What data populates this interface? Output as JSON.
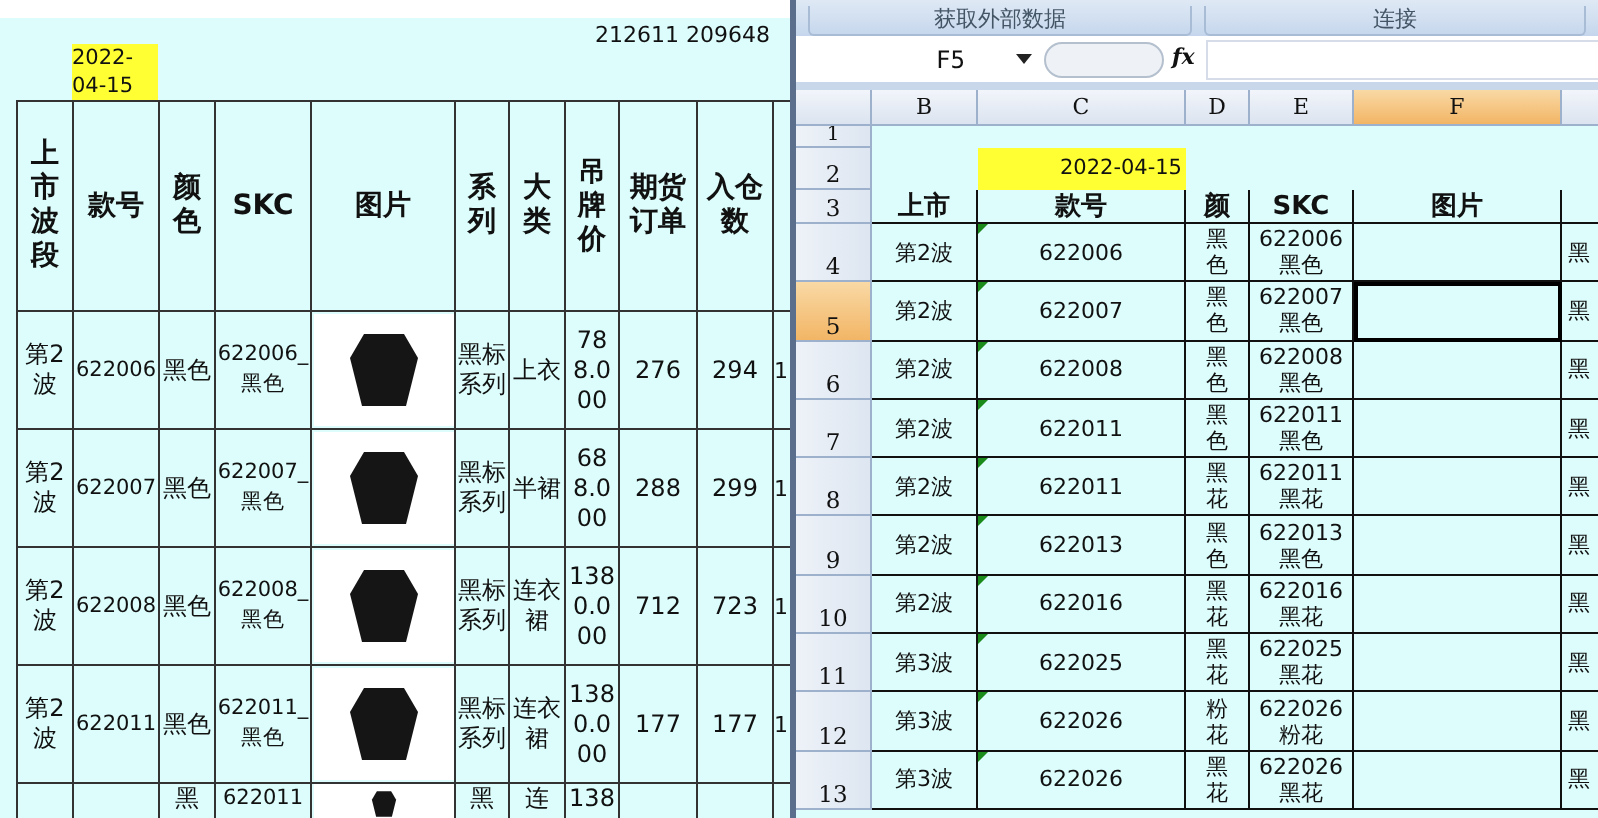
{
  "report": {
    "totals": "212611 209648",
    "date": "2022-04-15",
    "columns": [
      "上市波段",
      "款号",
      "颜色",
      "SKC",
      "图片",
      "系列",
      "大类",
      "吊牌价",
      "期货订单",
      "入仓数"
    ],
    "rows": [
      {
        "wave": "第2波",
        "style_no": "622006",
        "color_name": "黑色",
        "skc": "622006_黑色",
        "series": "黑标系列",
        "category": "上衣",
        "tag_price": "788.000",
        "futures_order": "276",
        "warehouse_qty": "294",
        "column_11": "1"
      },
      {
        "wave": "第2波",
        "style_no": "622007",
        "color_name": "黑色",
        "skc": "622007_黑色",
        "series": "黑标系列",
        "category": "半裙",
        "tag_price": "688.000",
        "futures_order": "288",
        "warehouse_qty": "299",
        "column_11": "1"
      },
      {
        "wave": "第2波",
        "style_no": "622008",
        "color_name": "黑色",
        "skc": "622008_黑色",
        "series": "黑标系列",
        "category": "连衣裙",
        "tag_price": "1380.000",
        "futures_order": "712",
        "warehouse_qty": "723",
        "column_11": "1"
      },
      {
        "wave": "第2波",
        "style_no": "622011",
        "color_name": "黑色",
        "skc": "622011_黑色",
        "series": "黑标系列",
        "category": "连衣裙",
        "tag_price": "1380.000",
        "futures_order": "177",
        "warehouse_qty": "177",
        "column_11": "1"
      },
      {
        "color_name": "黑",
        "skc": "622011",
        "series": "黑",
        "category": "连",
        "tag_price": "138"
      }
    ]
  },
  "excel": {
    "ribbon_groups": [
      "获取外部数据",
      "连接"
    ],
    "name_box": "F5",
    "function_label": "fx",
    "columns": [
      {
        "label": "B",
        "selected": false
      },
      {
        "label": "C",
        "selected": false
      },
      {
        "label": "D",
        "selected": false
      },
      {
        "label": "E",
        "selected": false
      },
      {
        "label": "F",
        "selected": true
      }
    ],
    "top_rows": [
      "1",
      "2",
      "3"
    ],
    "date": "2022-04-15",
    "header_row": [
      "上市",
      "款号",
      "颜",
      "SKC",
      "图片"
    ],
    "rows": [
      {
        "number": "4",
        "selected": false,
        "wave": "第2波",
        "style_no": "622006",
        "color_name": "黑色",
        "skc": "622006 黑色",
        "column_g": "黑"
      },
      {
        "number": "5",
        "selected": true,
        "wave": "第2波",
        "style_no": "622007",
        "color_name": "黑色",
        "skc": "622007 黑色",
        "column_g": "黑"
      },
      {
        "number": "6",
        "selected": false,
        "wave": "第2波",
        "style_no": "622008",
        "color_name": "黑色",
        "skc": "622008 黑色",
        "column_g": "黑"
      },
      {
        "number": "7",
        "selected": false,
        "wave": "第2波",
        "style_no": "622011",
        "color_name": "黑色",
        "skc": "622011 黑色",
        "column_g": "黑"
      },
      {
        "number": "8",
        "selected": false,
        "wave": "第2波",
        "style_no": "622011",
        "color_name": "黑花",
        "skc": "622011 黑花",
        "column_g": "黑"
      },
      {
        "number": "9",
        "selected": false,
        "wave": "第2波",
        "style_no": "622013",
        "color_name": "黑色",
        "skc": "622013 黑色",
        "column_g": "黑"
      },
      {
        "number": "10",
        "selected": false,
        "wave": "第2波",
        "style_no": "622016",
        "color_name": "黑花",
        "skc": "622016 黑花",
        "column_g": "黑"
      },
      {
        "number": "11",
        "selected": false,
        "wave": "第3波",
        "style_no": "622025",
        "color_name": "黑花",
        "skc": "622025 黑花",
        "column_g": "黑"
      },
      {
        "number": "12",
        "selected": false,
        "wave": "第3波",
        "style_no": "622026",
        "color_name": "粉花",
        "skc": "622026 粉花",
        "column_g": "黑"
      },
      {
        "number": "13",
        "selected": false,
        "wave": "第3波",
        "style_no": "622026",
        "color_name": "黑花",
        "skc": "622026 黑花",
        "column_g": "黑"
      }
    ]
  }
}
